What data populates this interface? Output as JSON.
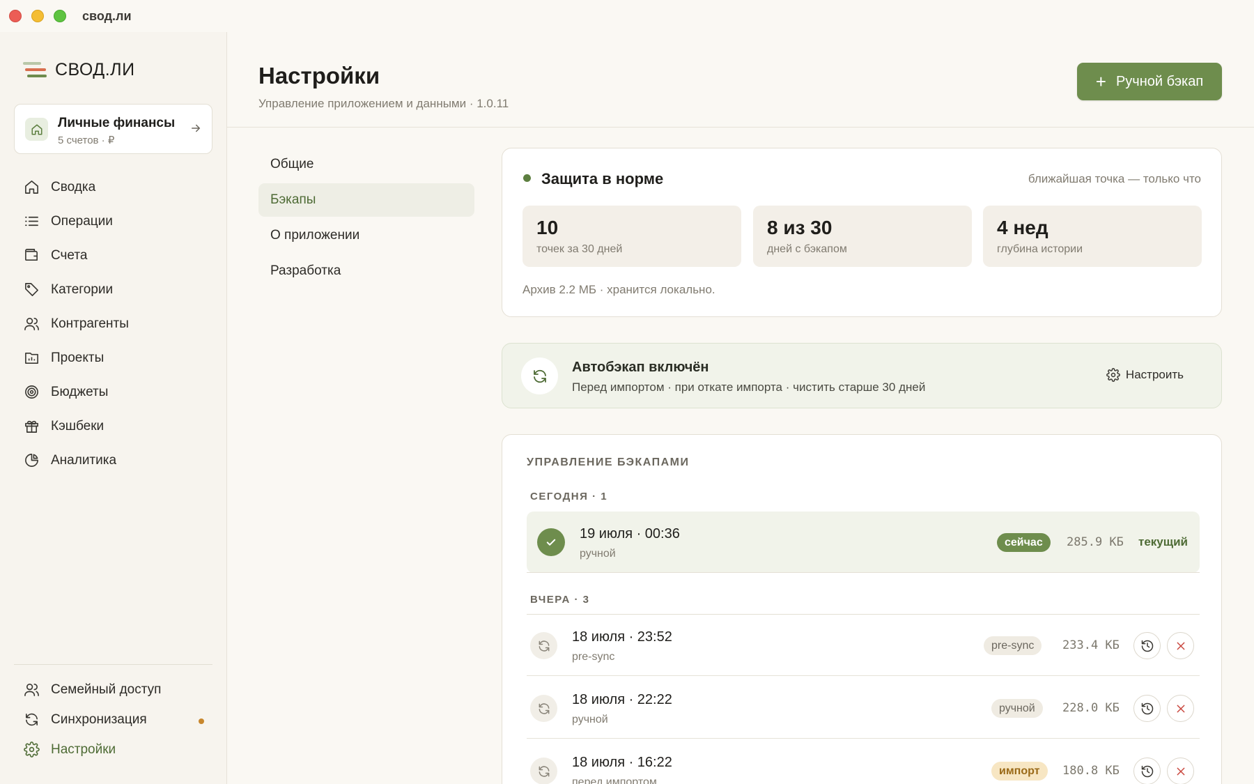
{
  "window": {
    "title": "свод.ли"
  },
  "brand": {
    "name": "СВОД.ЛИ"
  },
  "workspace": {
    "title": "Личные финансы",
    "subtitle": "5 счетов · ₽"
  },
  "sidebar": {
    "items": [
      {
        "label": "Сводка",
        "icon": "home-icon"
      },
      {
        "label": "Операции",
        "icon": "list-icon"
      },
      {
        "label": "Счета",
        "icon": "wallet-icon"
      },
      {
        "label": "Категории",
        "icon": "tag-icon"
      },
      {
        "label": "Контрагенты",
        "icon": "users-icon"
      },
      {
        "label": "Проекты",
        "icon": "folder-chart-icon"
      },
      {
        "label": "Бюджеты",
        "icon": "target-icon"
      },
      {
        "label": "Кэшбеки",
        "icon": "gift-icon"
      },
      {
        "label": "Аналитика",
        "icon": "pie-chart-icon"
      }
    ],
    "bottom": [
      {
        "label": "Семейный доступ",
        "icon": "users-icon"
      },
      {
        "label": "Синхронизация",
        "icon": "sync-icon"
      },
      {
        "label": "Настройки",
        "icon": "gear-icon"
      }
    ]
  },
  "header": {
    "title": "Настройки",
    "subtitle": "Управление приложением и данными · 1.0.11",
    "primary_button": "Ручной бэкап"
  },
  "subnav": {
    "items": [
      "Общие",
      "Бэкапы",
      "О приложении",
      "Разработка"
    ],
    "active": "Бэкапы"
  },
  "status": {
    "title": "Защита в норме",
    "latest": "ближайшая точка — только что",
    "stats": [
      {
        "value": "10",
        "label": "точек за 30 дней"
      },
      {
        "value": "8 из 30",
        "label": "дней с бэкапом"
      },
      {
        "value": "4 нед",
        "label": "глубина истории"
      }
    ],
    "archive": "Архив 2.2 МБ · хранится локально."
  },
  "autobackup": {
    "title": "Автобэкап включён",
    "subtitle": "Перед импортом · при откате импорта · чистить старше 30 дней",
    "configure": "Настроить"
  },
  "backups": {
    "title": "УПРАВЛЕНИЕ БЭКАПАМИ",
    "today_label": "СЕГОДНЯ · 1",
    "yesterday_label": "ВЧЕРА · 3",
    "current": {
      "date": "19 июля · 00:36",
      "kind": "ручной",
      "badge": "сейчас",
      "size": "285.9 КБ",
      "status": "текущий"
    },
    "rows": [
      {
        "date": "18 июля · 23:52",
        "kind": "pre-sync",
        "badge": "pre-sync",
        "size": "233.4 КБ"
      },
      {
        "date": "18 июля · 22:22",
        "kind": "ручной",
        "badge": "ручной",
        "size": "228.0 КБ"
      },
      {
        "date": "18 июля · 16:22",
        "kind": "перед импортом",
        "badge": "импорт",
        "size": "180.8 КБ"
      }
    ]
  },
  "colors": {
    "accent": "#6e8d4d",
    "accent_text": "#4e6b35",
    "warning": "#c8872d",
    "danger": "#c9463d"
  }
}
